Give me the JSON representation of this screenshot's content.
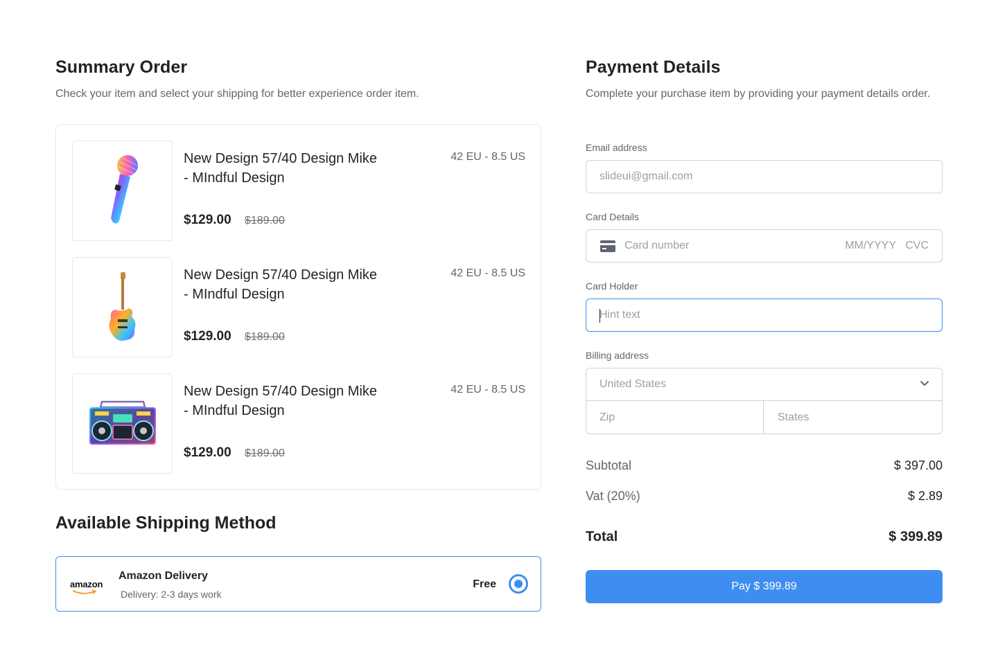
{
  "summary": {
    "title": "Summary Order",
    "subtitle": "Check your item and select your shipping for better experience order item.",
    "items": [
      {
        "name": "New Design 57/40 Design Mike - MIndful Design",
        "size": "42 EU - 8.5 US",
        "price": "$129.00",
        "old_price": "$189.00",
        "icon": "microphone-image"
      },
      {
        "name": "New Design 57/40 Design Mike - MIndful Design",
        "size": "42 EU - 8.5 US",
        "price": "$129.00",
        "old_price": "$189.00",
        "icon": "guitar-image"
      },
      {
        "name": "New Design 57/40 Design Mike - MIndful Design",
        "size": "42 EU - 8.5 US",
        "price": "$129.00",
        "old_price": "$189.00",
        "icon": "boombox-image"
      }
    ]
  },
  "shipping": {
    "title": "Available Shipping Method",
    "method": {
      "logo": "amazon",
      "name": "Amazon Delivery",
      "subtitle": "Delivery: 2-3 days work",
      "price": "Free",
      "selected": true
    }
  },
  "payment": {
    "title": "Payment Details",
    "subtitle": "Complete your purchase item by providing your payment details order.",
    "email": {
      "label": "Email address",
      "placeholder": "slideui@gmail.com"
    },
    "card": {
      "label": "Card Details",
      "placeholder": "Card number",
      "expiry": "MM/YYYY",
      "cvc": "CVC",
      "icon": "credit-card-icon"
    },
    "holder": {
      "label": "Card Holder",
      "placeholder": "Hint text"
    },
    "billing": {
      "label": "Billing address",
      "country": "United States",
      "zip": "Zip",
      "state": "States"
    }
  },
  "totals": {
    "subtotal_label": "Subtotal",
    "subtotal": "$ 397.00",
    "vat_label": "Vat (20%)",
    "vat": "$ 2.89",
    "total_label": "Total",
    "total": "$ 399.89"
  },
  "pay_button": "Pay $ 399.89",
  "colors": {
    "accent": "#3d8ef0",
    "text": "#1f2328",
    "muted": "#5f6570",
    "border": "#cfd3d8"
  }
}
